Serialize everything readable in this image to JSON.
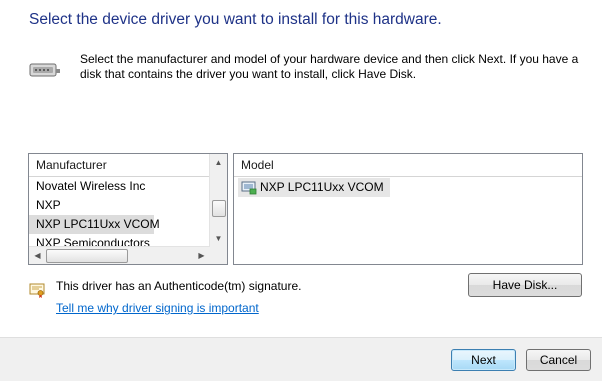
{
  "title": "Select the device driver you want to install for this hardware.",
  "intro_text": "Select the manufacturer and model of your hardware device and then click Next. If you have a disk that contains the driver you want to install, click Have Disk.",
  "manufacturer_pane": {
    "header": "Manufacturer",
    "items": [
      "Novatel Wireless Inc",
      "NXP",
      "NXP LPC11Uxx VCOM",
      "NXP Semiconductors"
    ],
    "selected": "NXP LPC11Uxx VCOM"
  },
  "model_pane": {
    "header": "Model",
    "items": [
      "NXP LPC11Uxx  VCOM"
    ]
  },
  "signature_text": "This driver has an Authenticode(tm) signature.",
  "signing_link": "Tell me why driver signing is important",
  "buttons": {
    "have_disk": "Have Disk...",
    "next": "Next",
    "cancel": "Cancel"
  },
  "icons": {
    "hardware": "hardware-device-icon",
    "certificate": "certificate-icon",
    "model": "device-driver-icon"
  },
  "colors": {
    "title": "#1e3287",
    "link": "#0066cc",
    "footer_bg": "#f0f0f0",
    "selected_bg": "#dcdcdc"
  }
}
